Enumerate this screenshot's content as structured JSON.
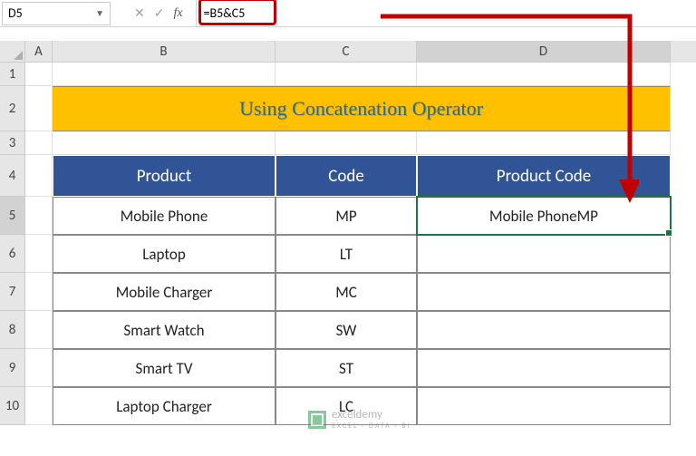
{
  "formula_bar": {
    "name_box": "D5",
    "formula": "=B5&C5"
  },
  "columns": [
    "A",
    "B",
    "C",
    "D"
  ],
  "row_numbers": [
    "1",
    "2",
    "3",
    "4",
    "5",
    "6",
    "7",
    "8",
    "9",
    "10"
  ],
  "title": "Using Concatenation Operator",
  "headers": {
    "product": "Product",
    "code": "Code",
    "product_code": "Product Code"
  },
  "rows": [
    {
      "product": "Mobile Phone",
      "code": "MP",
      "product_code": "Mobile PhoneMP"
    },
    {
      "product": "Laptop",
      "code": "LT",
      "product_code": ""
    },
    {
      "product": "Mobile Charger",
      "code": "MC",
      "product_code": ""
    },
    {
      "product": "Smart Watch",
      "code": "SW",
      "product_code": ""
    },
    {
      "product": "Smart TV",
      "code": "ST",
      "product_code": ""
    },
    {
      "product": "Laptop Charger",
      "code": "LC",
      "product_code": ""
    }
  ],
  "watermark": {
    "name": "exceldemy",
    "sub": "EXCEL · DATA · BI"
  },
  "active_cell": "D5"
}
